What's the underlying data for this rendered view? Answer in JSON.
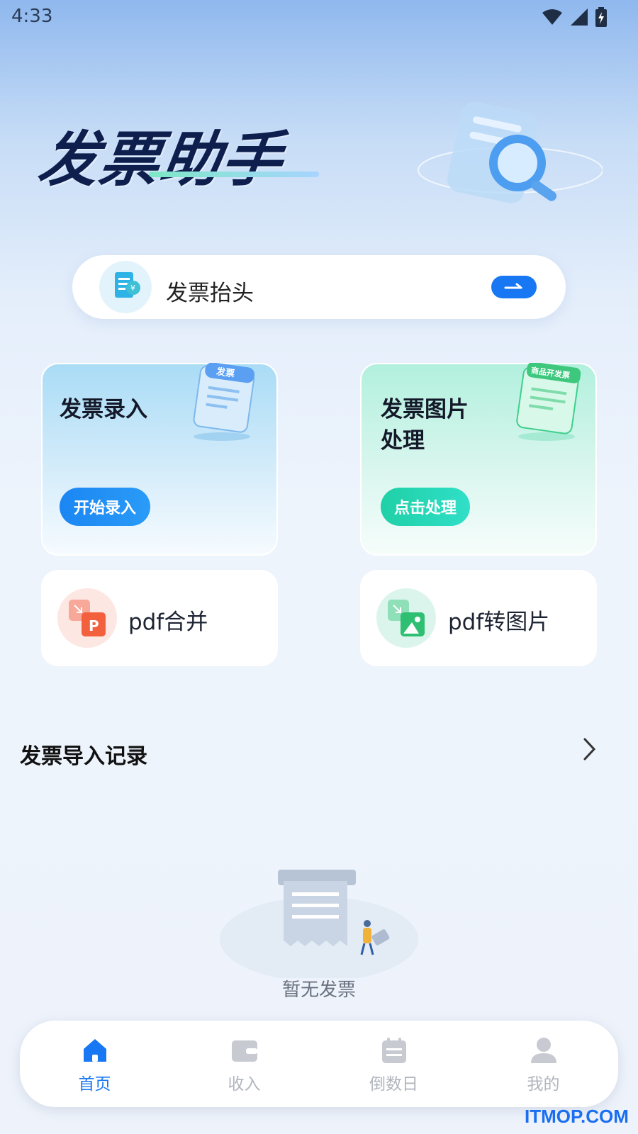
{
  "status_bar": {
    "time": "4:33"
  },
  "hero": {
    "title": "发票助手"
  },
  "invoice_header": {
    "label": "发票抬头"
  },
  "cards": {
    "entry": {
      "title": "发票录入",
      "button": "开始录入",
      "art_label": "发票"
    },
    "image": {
      "title_line1": "发票图片",
      "title_line2": "处理",
      "button": "点击处理",
      "art_label": "商品开发票"
    }
  },
  "tools": {
    "pdf_merge": "pdf合并",
    "pdf_to_image": "pdf转图片"
  },
  "records": {
    "title": "发票导入记录",
    "empty": "暂无发票"
  },
  "nav": {
    "items": [
      {
        "label": "首页",
        "icon": "home-icon",
        "active": true
      },
      {
        "label": "收入",
        "icon": "wallet-icon",
        "active": false
      },
      {
        "label": "倒数日",
        "icon": "calendar-icon",
        "active": false
      },
      {
        "label": "我的",
        "icon": "user-icon",
        "active": false
      }
    ]
  },
  "watermark": "ITMOP.COM",
  "colors": {
    "accent_blue": "#1877f2",
    "accent_green": "#1fd0a7",
    "title_navy": "#0e1f4e"
  }
}
